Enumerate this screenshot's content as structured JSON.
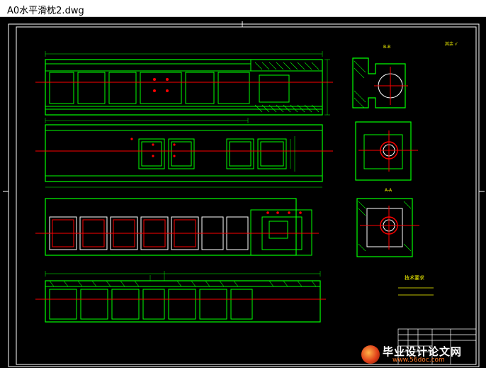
{
  "window": {
    "title": "A0水平滑枕2.dwg"
  },
  "drawing": {
    "line_color": "#00ff00",
    "center_color": "#ff0000",
    "hatch_color": "#00ff00",
    "frame_color": "#ffffff",
    "dim_color": "#00ff00",
    "text_color": "#ffff00",
    "section_labels": [
      "B-B",
      "A-A"
    ],
    "notes_heading": "技术要求",
    "roughness_mark": "其余 √"
  },
  "watermark": {
    "brand": "毕业设计论文网",
    "url": "www.56doc.com"
  }
}
